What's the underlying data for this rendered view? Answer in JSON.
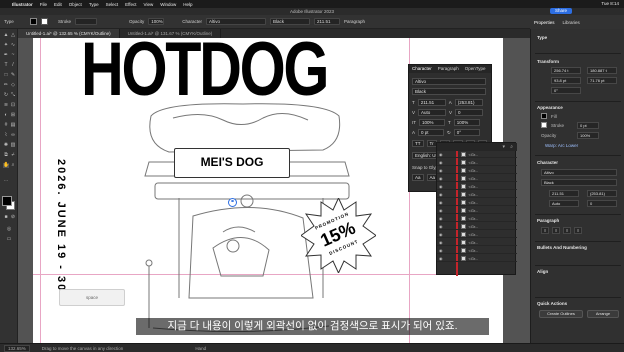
{
  "menubar": {
    "app_name": "Illustrator",
    "items": [
      "File",
      "Edit",
      "Object",
      "Type",
      "Select",
      "Effect",
      "View",
      "Window",
      "Help"
    ],
    "clock": "Tue 8:14"
  },
  "window": {
    "title": "Adobe Illustrator 2023",
    "share_label": "Share"
  },
  "controlbar": {
    "type_label": "Type",
    "stroke_label": "Stroke",
    "opacity_label": "Opacity",
    "opacity_value": "100%",
    "character_label": "Character",
    "font": "Altivo",
    "font_style": "Black",
    "font_size": "211.51",
    "paragraph_label": "Paragraph"
  },
  "right_tabs": [
    "Properties",
    "Libraries"
  ],
  "doc_tabs": [
    {
      "label": "Untitled-1.ai* @ 132.65 % (CMYK/Outline)",
      "active": true
    },
    {
      "label": "Untitled-1.ai* @ 131.67 % (CMYK/Outline)",
      "active": false
    }
  ],
  "artwork": {
    "headline": "HOTDOG",
    "sign": "MEI'S DOG",
    "date_vertical": "2026. JUNE 19 - 30",
    "promo_top": "PROMOTION",
    "promo_big": "15%",
    "promo_bottom": "DISCOUNT",
    "tooltip": "space"
  },
  "character_panel": {
    "tabs": [
      "Character",
      "Paragraph",
      "OpenType"
    ],
    "font": "Altivo",
    "style": "Black",
    "size": "211.51",
    "leading": "(253.81)",
    "kerning": "Auto",
    "tracking": "0",
    "horizontal_scale": "100%",
    "vertical_scale": "100%",
    "baseline": "0 pt",
    "rotation": "0°",
    "language": "English: UK",
    "aa": "Sharp",
    "snap": "Snap to Glyph"
  },
  "layers": {
    "rows": [
      "<Gr...",
      "<Gr...",
      "<Gr...",
      "<Gr...",
      "<Gr...",
      "<Gr...",
      "<Gr...",
      "<Gr...",
      "<Gr...",
      "<Gr...",
      "<Gr...",
      "<Gr...",
      "<Gr...",
      "<Gr..."
    ]
  },
  "properties": {
    "type_label": "Type",
    "transform_label": "Transform",
    "x": "256.74 t",
    "y": "180.887 t",
    "w": "93.8 pt",
    "h": "71.76 pt",
    "rotation": "0°",
    "appearance_label": "Appearance",
    "fill_label": "Fill",
    "stroke_label": "Stroke",
    "stroke_value": "0 pt",
    "opacity_label": "Opacity",
    "opacity_value": "100%",
    "effect": "Warp: Arc Lower",
    "character_label": "Character",
    "font": "Altivo",
    "style": "Black",
    "size": "211.51",
    "leading": "(253.81)",
    "kerning": "Auto",
    "tracking": "0",
    "paragraph_label": "Paragraph",
    "bullets_label": "Bullets And Numbering",
    "align_label": "Align",
    "quick_actions_label": "Quick Actions",
    "create_outlines": "Create Outlines",
    "arrange": "Arrange"
  },
  "subtitle": "지금 다 내용이 이렇게 외곽선이 없이 검정색으로 표시가 되어 있죠.",
  "statusbar": {
    "zoom": "132.65%",
    "tip": "Drag to move the canvas in any direction",
    "tool": "Hand"
  }
}
